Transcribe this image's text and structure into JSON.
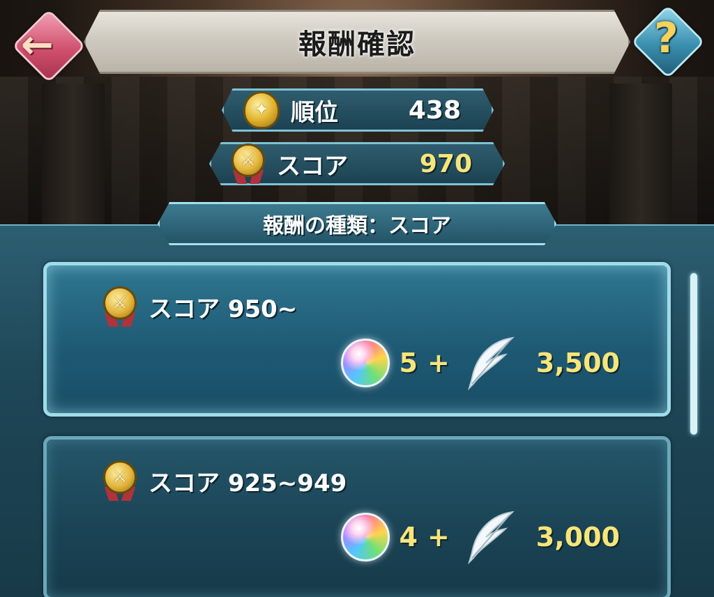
{
  "header": {
    "title": "報酬確認",
    "back_icon": "back-arrow-icon",
    "help_icon": "question-mark-icon",
    "back_color": "#d0506e",
    "help_color": "#3a8fae"
  },
  "stats": {
    "rank_label": "順位",
    "rank_value": "438",
    "score_label": "スコア",
    "score_value": "970"
  },
  "reward_type": {
    "label": "報酬の種類：スコア"
  },
  "rewards": [
    {
      "tier": "スコア 950~",
      "orb_count": "5",
      "plus": "+",
      "feather_count": "3,500"
    },
    {
      "tier": "スコア 925~949",
      "orb_count": "4",
      "plus": "+",
      "feather_count": "3,000"
    }
  ],
  "colors": {
    "accent_gold": "#f7e57a",
    "panel_teal": "#1d5872",
    "border_light": "#9fdcea"
  }
}
